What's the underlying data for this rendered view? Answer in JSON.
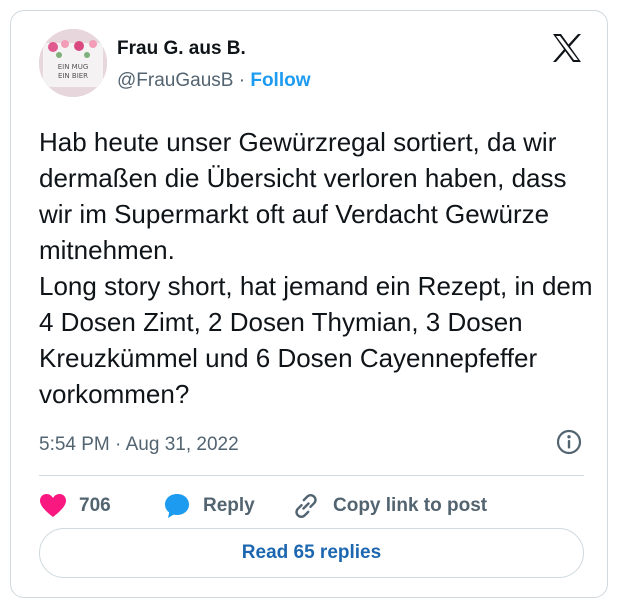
{
  "author": {
    "name": "Frau G. aus B.",
    "handle": "@FrauGausB",
    "separator": "·",
    "follow_label": "Follow",
    "avatar_text": "EIN MUG EIN BIER"
  },
  "icons": {
    "logo": "x-logo-icon",
    "info": "info-icon",
    "like": "heart-icon",
    "reply": "speech-bubble-icon",
    "copy": "link-icon"
  },
  "tweet": {
    "text": "Hab heute unser Gewürzregal sortiert, da wir dermaßen die Übersicht verloren haben, dass wir im Supermarkt oft auf Verdacht Gewürze mitnehmen.\nLong story short, hat jemand ein Rezept, in dem 4 Dosen Zimt, 2 Dosen Thymian, 3 Dosen Kreuzkümmel und 6 Dosen Cayennepfeffer vorkommen?",
    "time": "5:54 PM",
    "date": "Aug 31, 2022",
    "meta_separator": "·"
  },
  "actions": {
    "like_count": "706",
    "reply_label": "Reply",
    "copy_label": "Copy link to post",
    "read_replies_label": "Read 65 replies"
  },
  "colors": {
    "accent": "#1d9bf0",
    "heart": "#f91880",
    "text_secondary": "#536471",
    "border": "#cfd9de"
  }
}
